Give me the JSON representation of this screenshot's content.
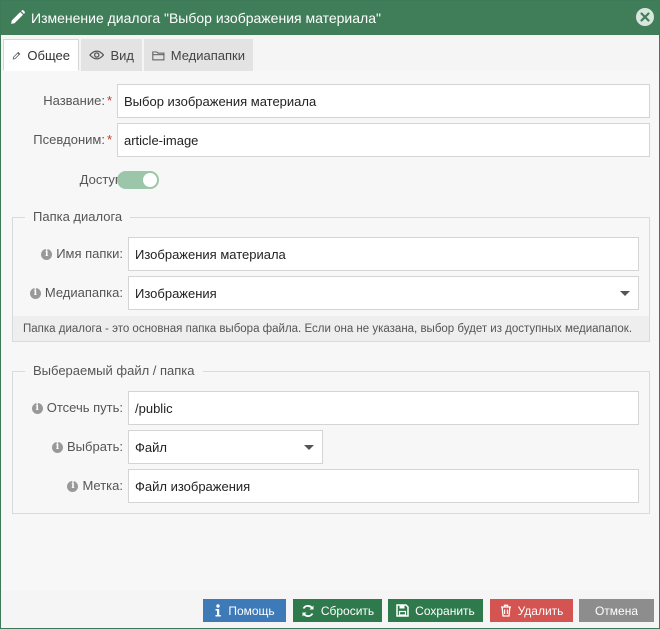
{
  "window": {
    "title": "Изменение диалога \"Выбор изображения материала\""
  },
  "tabs": [
    {
      "label": "Общее",
      "icon": "pencil-icon",
      "active": true
    },
    {
      "label": "Вид",
      "icon": "eye-icon",
      "active": false
    },
    {
      "label": "Медиапапки",
      "icon": "folder-icon",
      "active": false
    }
  ],
  "form": {
    "name_label": "Название:",
    "name_value": "Выбор изображения материала",
    "alias_label": "Псевдоним:",
    "alias_value": "article-image",
    "required_mark": "*",
    "enabled_label": "Доступен:",
    "enabled": true
  },
  "dialog_folder": {
    "legend": "Папка диалога",
    "folder_name_label": "Имя папки:",
    "folder_name_value": "Изображения материала",
    "media_folder_label": "Медиапапка:",
    "media_folder_value": "Изображения",
    "note": "Папка диалога - это основная папка выбора файла. Если она не указана, выбор будет из доступных медиапапок."
  },
  "selected": {
    "legend": "Выбераемый файл / папка",
    "cut_path_label": "Отсечь путь:",
    "cut_path_value": "/public",
    "select_label": "Выбрать:",
    "select_value": "Файл",
    "tag_label": "Метка:",
    "tag_value": "Файл изображения"
  },
  "buttons": {
    "help": "Помощь",
    "reset": "Сбросить",
    "save": "Сохранить",
    "delete": "Удалить",
    "cancel": "Отмена"
  },
  "colors": {
    "titlebar": "#407e5a",
    "help": "#3f7ab8",
    "green": "#2f7a4c",
    "delete": "#d45451",
    "cancel": "#8d8d8d"
  }
}
